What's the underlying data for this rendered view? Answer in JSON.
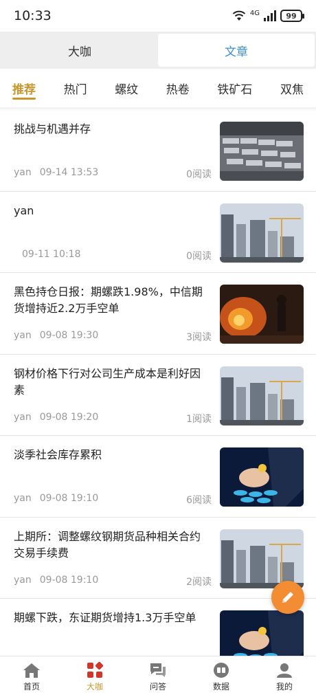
{
  "status_bar": {
    "time": "10:33",
    "network": "4G",
    "battery": "99"
  },
  "segments": [
    {
      "label": "大咖",
      "active": false
    },
    {
      "label": "文章",
      "active": true
    }
  ],
  "categories": [
    {
      "label": "推荐",
      "active": true
    },
    {
      "label": "热门"
    },
    {
      "label": "螺纹"
    },
    {
      "label": "热卷"
    },
    {
      "label": "铁矿石"
    },
    {
      "label": "双焦"
    }
  ],
  "articles": [
    {
      "title": "挑战与机遇并存",
      "author": "yan",
      "date": "09-14 13:53",
      "reads": "0阅读",
      "image": "steel-bars-image"
    },
    {
      "title": "yan",
      "author": "",
      "date": "09-11 10:18",
      "reads": "0阅读",
      "image": "city-construction-image"
    },
    {
      "title": "黑色持仓日报：期螺跌1.98%，中信期货增持近2.2万手空单",
      "author": "yan",
      "date": "09-08 19:30",
      "reads": "3阅读",
      "image": "steel-furnace-image"
    },
    {
      "title": "钢材价格下行对公司生产成本是利好因素",
      "author": "yan",
      "date": "09-08 19:20",
      "reads": "1阅读",
      "image": "city-construction-image"
    },
    {
      "title": "淡季社会库存累积",
      "author": "yan",
      "date": "09-08 19:10",
      "reads": "6阅读",
      "image": "finance-coins-image"
    },
    {
      "title": "上期所：调整螺纹钢期货品种相关合约交易手续费",
      "author": "yan",
      "date": "09-08 19:10",
      "reads": "2阅读",
      "image": "city-construction-image"
    },
    {
      "title": "期螺下跌，东证期货增持1.3万手空单",
      "author": "",
      "date": "",
      "reads": "",
      "image": "finance-coins-image"
    }
  ],
  "bottom_nav": [
    {
      "label": "首页",
      "icon": "home-icon"
    },
    {
      "label": "大咖",
      "icon": "grid-icon",
      "active": true
    },
    {
      "label": "问答",
      "icon": "chat-icon"
    },
    {
      "label": "数据",
      "icon": "data-icon"
    },
    {
      "label": "我的",
      "icon": "user-icon"
    }
  ],
  "colors": {
    "accent_gold": "#c9962b",
    "accent_blue": "#3a8ed8",
    "fab": "#f28d34"
  }
}
